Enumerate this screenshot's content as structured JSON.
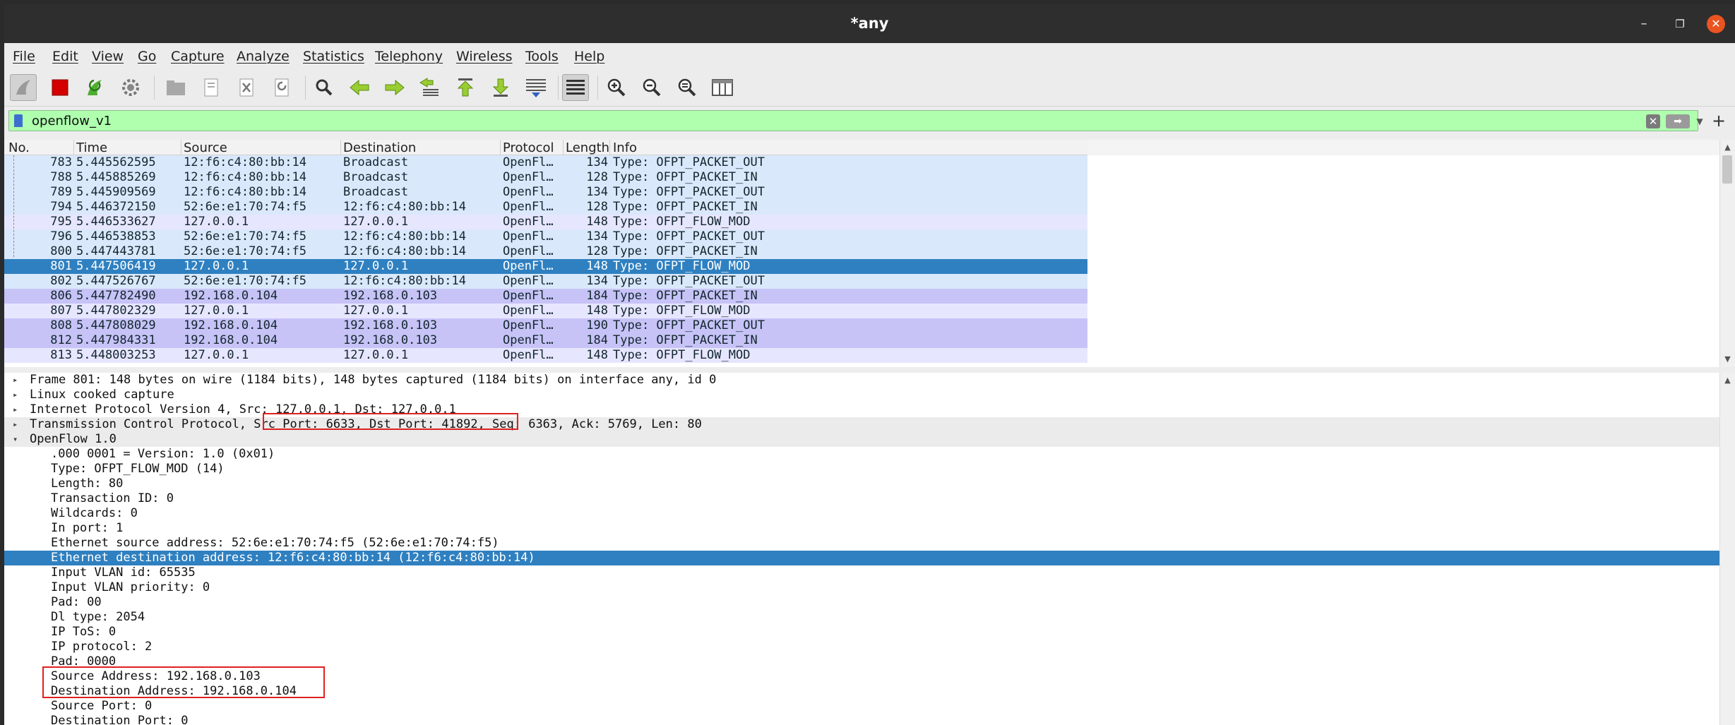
{
  "window": {
    "title": "*any"
  },
  "menu": [
    "File",
    "Edit",
    "View",
    "Go",
    "Capture",
    "Analyze",
    "Statistics",
    "Telephony",
    "Wireless",
    "Tools",
    "Help"
  ],
  "toolbar": {
    "icons": [
      "shark-fin-start-icon",
      "stop-capture-icon",
      "restart-capture-icon",
      "capture-options-gear-icon",
      "open-file-icon",
      "save-file-icon",
      "close-file-icon",
      "reload-file-icon",
      "find-packet-icon",
      "go-back-icon",
      "go-forward-icon",
      "go-to-packet-icon",
      "go-first-packet-icon",
      "go-last-packet-icon",
      "autoscroll-icon",
      "colorize-icon",
      "zoom-in-icon",
      "zoom-out-icon",
      "normal-size-icon",
      "resize-columns-icon"
    ]
  },
  "filter": {
    "value": "openflow_v1"
  },
  "packet_list": {
    "columns": [
      "No.",
      "Time",
      "Source",
      "Destination",
      "Protocol",
      "Length",
      "Info"
    ],
    "rows": [
      {
        "no": "783",
        "time": "5.445562595",
        "src": "12:f6:c4:80:bb:14",
        "dst": "Broadcast",
        "proto": "OpenFl…",
        "len": "134",
        "info": "Type: OFPT_PACKET_OUT",
        "bg": "#dae8fc"
      },
      {
        "no": "788",
        "time": "5.445885269",
        "src": "12:f6:c4:80:bb:14",
        "dst": "Broadcast",
        "proto": "OpenFl…",
        "len": "128",
        "info": "Type: OFPT_PACKET_IN",
        "bg": "#dae8fc"
      },
      {
        "no": "789",
        "time": "5.445909569",
        "src": "12:f6:c4:80:bb:14",
        "dst": "Broadcast",
        "proto": "OpenFl…",
        "len": "134",
        "info": "Type: OFPT_PACKET_OUT",
        "bg": "#dae8fc"
      },
      {
        "no": "794",
        "time": "5.446372150",
        "src": "52:6e:e1:70:74:f5",
        "dst": "12:f6:c4:80:bb:14",
        "proto": "OpenFl…",
        "len": "128",
        "info": "Type: OFPT_PACKET_IN",
        "bg": "#dae8fc"
      },
      {
        "no": "795",
        "time": "5.446533627",
        "src": "127.0.0.1",
        "dst": "127.0.0.1",
        "proto": "OpenFl…",
        "len": "148",
        "info": "Type: OFPT_FLOW_MOD",
        "bg": "#e7e6ff"
      },
      {
        "no": "796",
        "time": "5.446538853",
        "src": "52:6e:e1:70:74:f5",
        "dst": "12:f6:c4:80:bb:14",
        "proto": "OpenFl…",
        "len": "134",
        "info": "Type: OFPT_PACKET_OUT",
        "bg": "#dae8fc"
      },
      {
        "no": "800",
        "time": "5.447443781",
        "src": "52:6e:e1:70:74:f5",
        "dst": "12:f6:c4:80:bb:14",
        "proto": "OpenFl…",
        "len": "128",
        "info": "Type: OFPT_PACKET_IN",
        "bg": "#dae8fc"
      },
      {
        "no": "801",
        "time": "5.447506419",
        "src": "127.0.0.1",
        "dst": "127.0.0.1",
        "proto": "OpenFl…",
        "len": "148",
        "info": "Type: OFPT_FLOW_MOD",
        "bg": "#2f80c0",
        "selected": true
      },
      {
        "no": "802",
        "time": "5.447526767",
        "src": "52:6e:e1:70:74:f5",
        "dst": "12:f6:c4:80:bb:14",
        "proto": "OpenFl…",
        "len": "134",
        "info": "Type: OFPT_PACKET_OUT",
        "bg": "#dae8fc"
      },
      {
        "no": "806",
        "time": "5.447782490",
        "src": "192.168.0.104",
        "dst": "192.168.0.103",
        "proto": "OpenFl…",
        "len": "184",
        "info": "Type: OFPT_PACKET_IN",
        "bg": "#c7c3f7"
      },
      {
        "no": "807",
        "time": "5.447802329",
        "src": "127.0.0.1",
        "dst": "127.0.0.1",
        "proto": "OpenFl…",
        "len": "148",
        "info": "Type: OFPT_FLOW_MOD",
        "bg": "#e7e6ff"
      },
      {
        "no": "808",
        "time": "5.447808029",
        "src": "192.168.0.104",
        "dst": "192.168.0.103",
        "proto": "OpenFl…",
        "len": "190",
        "info": "Type: OFPT_PACKET_OUT",
        "bg": "#c7c3f7"
      },
      {
        "no": "812",
        "time": "5.447984331",
        "src": "192.168.0.104",
        "dst": "192.168.0.103",
        "proto": "OpenFl…",
        "len": "184",
        "info": "Type: OFPT_PACKET_IN",
        "bg": "#c7c3f7"
      },
      {
        "no": "813",
        "time": "5.448003253",
        "src": "127.0.0.1",
        "dst": "127.0.0.1",
        "proto": "OpenFl…",
        "len": "148",
        "info": "Type: OFPT_FLOW_MOD",
        "bg": "#e7e6ff"
      }
    ]
  },
  "details": {
    "rows": [
      {
        "text": "Frame 801: 148 bytes on wire (1184 bits), 148 bytes captured (1184 bits) on interface any, id 0",
        "level": 0,
        "expander": "▸",
        "bg": "#ffffff"
      },
      {
        "text": "Linux cooked capture",
        "level": 0,
        "expander": "▸",
        "bg": "#ffffff"
      },
      {
        "text": "Internet Protocol Version 4, Src: 127.0.0.1, Dst: 127.0.0.1",
        "level": 0,
        "expander": "▸",
        "bg": "#ffffff"
      },
      {
        "text": "Transmission Control Protocol, Src Port: 6633, Dst Port: 41892, Seq: 6363, Ack: 5769, Len: 80",
        "level": 0,
        "expander": "▸",
        "bg": "#ebebeb"
      },
      {
        "text": "OpenFlow 1.0",
        "level": 0,
        "expander": "▾",
        "bg": "#ebebeb"
      },
      {
        "text": ".000 0001 = Version: 1.0 (0x01)",
        "level": 1,
        "expander": "",
        "bg": "#ffffff"
      },
      {
        "text": "Type: OFPT_FLOW_MOD (14)",
        "level": 1,
        "expander": "",
        "bg": "#ffffff"
      },
      {
        "text": "Length: 80",
        "level": 1,
        "expander": "",
        "bg": "#ffffff"
      },
      {
        "text": "Transaction ID: 0",
        "level": 1,
        "expander": "",
        "bg": "#ffffff"
      },
      {
        "text": "Wildcards: 0",
        "level": 1,
        "expander": "",
        "bg": "#ffffff"
      },
      {
        "text": "In port: 1",
        "level": 1,
        "expander": "",
        "bg": "#ffffff"
      },
      {
        "text": "Ethernet source address: 52:6e:e1:70:74:f5 (52:6e:e1:70:74:f5)",
        "level": 1,
        "expander": "",
        "bg": "#ffffff"
      },
      {
        "text": "Ethernet destination address: 12:f6:c4:80:bb:14 (12:f6:c4:80:bb:14)",
        "level": 1,
        "expander": "",
        "bg": "#2f80c0",
        "selected": true
      },
      {
        "text": "Input VLAN id: 65535",
        "level": 1,
        "expander": "",
        "bg": "#ffffff"
      },
      {
        "text": "Input VLAN priority: 0",
        "level": 1,
        "expander": "",
        "bg": "#ffffff"
      },
      {
        "text": "Pad: 00",
        "level": 1,
        "expander": "",
        "bg": "#ffffff"
      },
      {
        "text": "Dl type: 2054",
        "level": 1,
        "expander": "",
        "bg": "#ffffff"
      },
      {
        "text": "IP ToS: 0",
        "level": 1,
        "expander": "",
        "bg": "#ffffff"
      },
      {
        "text": "IP protocol: 2",
        "level": 1,
        "expander": "",
        "bg": "#ffffff"
      },
      {
        "text": "Pad: 0000",
        "level": 1,
        "expander": "",
        "bg": "#ffffff"
      },
      {
        "text": "Source Address: 192.168.0.103",
        "level": 1,
        "expander": "",
        "bg": "#ffffff"
      },
      {
        "text": "Destination Address: 192.168.0.104",
        "level": 1,
        "expander": "",
        "bg": "#ffffff"
      },
      {
        "text": "Source Port: 0",
        "level": 1,
        "expander": "",
        "bg": "#ffffff"
      },
      {
        "text": "Destination Port: 0",
        "level": 1,
        "expander": "",
        "bg": "#ffffff"
      }
    ]
  },
  "colors": {
    "selection": "#2f80c0",
    "filter_valid": "#afffaf",
    "annotation": "#e02020"
  }
}
